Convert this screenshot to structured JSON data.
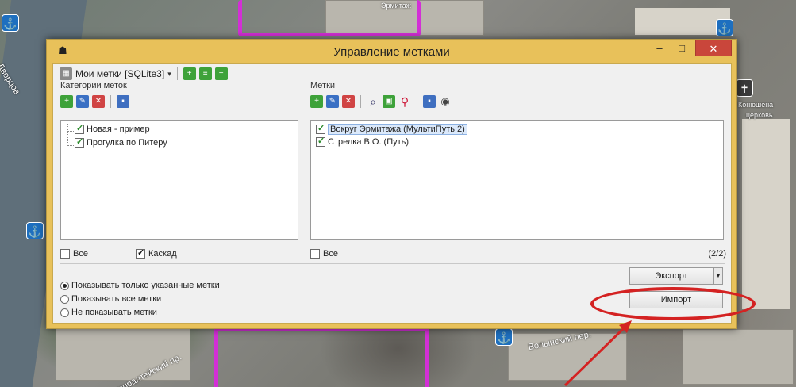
{
  "dialog": {
    "title": "Управление метками"
  },
  "db_toolbar": {
    "label": "Мои метки [SQLite3]"
  },
  "categories": {
    "label": "Категории меток",
    "items": [
      {
        "label": "Новая - пример",
        "checked": true
      },
      {
        "label": "Прогулка по Питеру",
        "checked": true
      }
    ],
    "all_label": "Все",
    "all_checked": false,
    "cascade_label": "Каскад",
    "cascade_checked": true
  },
  "marks": {
    "label": "Метки",
    "items": [
      {
        "label": "Вокруг Эрмитажа (МультиПуть 2)",
        "checked": true,
        "selected": true
      },
      {
        "label": "Стрелка В.О. (Путь)",
        "checked": true,
        "selected": false
      }
    ],
    "all_label": "Все",
    "all_checked": false,
    "count": "(2/2)"
  },
  "display_options": {
    "options": [
      {
        "label": "Показывать только указанные метки",
        "selected": true
      },
      {
        "label": "Показывать все метки",
        "selected": false
      },
      {
        "label": "Не показывать метки",
        "selected": false
      }
    ]
  },
  "actions": {
    "export_label": "Экспорт",
    "import_label": "Импорт"
  },
  "map_labels": [
    "Дворцов",
    "Эрмитаж",
    "Конюшена",
    "церковь",
    "Волынский пер.",
    "Адмиралтейский пр."
  ],
  "colors": {
    "window_frame": "#e8c15a",
    "close_button": "#c9463b",
    "route": "#d32fd6",
    "annotation": "#d42222"
  }
}
